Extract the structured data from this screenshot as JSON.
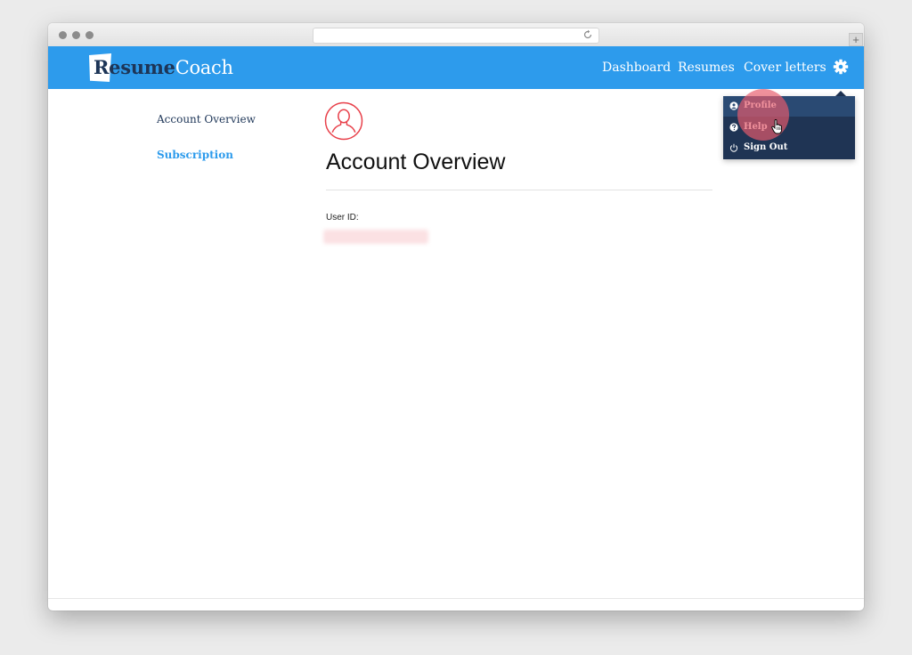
{
  "logo": {
    "part1": "Resume",
    "part2": "Coach"
  },
  "nav": {
    "items": [
      {
        "label": "Dashboard"
      },
      {
        "label": "Resumes"
      },
      {
        "label": "Cover letters"
      }
    ],
    "settings_icon": "gear-icon"
  },
  "dropdown": {
    "items": [
      {
        "label": "Profile",
        "icon": "user-circle-icon",
        "active": true
      },
      {
        "label": "Help",
        "icon": "question-circle-icon",
        "active": false
      },
      {
        "label": "Sign Out",
        "icon": "power-icon",
        "active": false
      }
    ]
  },
  "sidebar": {
    "items": [
      {
        "label": "Account Overview"
      },
      {
        "label": "Subscription"
      }
    ]
  },
  "main": {
    "title": "Account Overview",
    "user_id_label": "User ID:"
  },
  "colors": {
    "brand_blue": "#2d9bec",
    "navy": "#1d3557",
    "dropdown_bg": "#1f3454",
    "avatar_red": "#e8404a"
  }
}
